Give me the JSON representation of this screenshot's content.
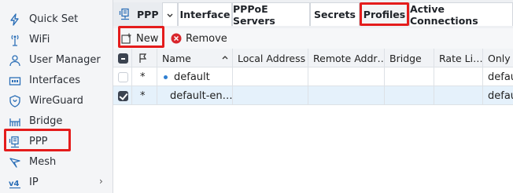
{
  "sidebar": {
    "items": [
      {
        "label": "Quick Set",
        "icon": "quick-set-icon"
      },
      {
        "label": "WiFi",
        "icon": "wifi-icon"
      },
      {
        "label": "User Manager",
        "icon": "user-manager-icon"
      },
      {
        "label": "Interfaces",
        "icon": "interfaces-icon"
      },
      {
        "label": "WireGuard",
        "icon": "wireguard-icon"
      },
      {
        "label": "Bridge",
        "icon": "bridge-icon"
      },
      {
        "label": "PPP",
        "icon": "ppp-icon"
      },
      {
        "label": "Mesh",
        "icon": "mesh-icon"
      },
      {
        "label": "IP",
        "icon": "ip-icon"
      }
    ]
  },
  "tabs": {
    "app": "PPP",
    "items": [
      "Interface",
      "PPPoE Servers",
      "Secrets",
      "Profiles",
      "Active Connections"
    ]
  },
  "toolbar": {
    "new_label": "New",
    "remove_label": "Remove"
  },
  "table": {
    "columns": [
      "Name",
      "Local Address",
      "Remote Addr…",
      "Bridge",
      "Rate Li…",
      "Only o"
    ],
    "rows": [
      {
        "flag": "*",
        "name": "default",
        "only": "defau",
        "selected": false
      },
      {
        "flag": "*",
        "name": "default-en…",
        "only": "defau",
        "selected": true
      }
    ]
  },
  "colors": {
    "highlight": "#e41c1c",
    "accent": "#2f7fd1",
    "remove": "#d9262c"
  }
}
